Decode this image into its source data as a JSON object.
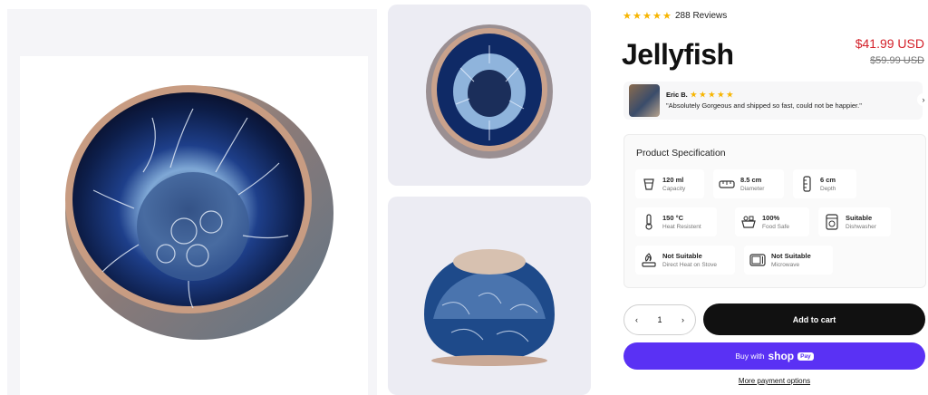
{
  "product": {
    "title": "Jellyfish",
    "price": "$41.99 USD",
    "compare_price": "$59.99 USD",
    "rating_stars": 5,
    "reviews_label": "288 Reviews"
  },
  "testimonial": {
    "name": "Eric B.",
    "quote": "\"Absolutely Gorgeous and shipped so fast, could not be happier.\""
  },
  "spec": {
    "title": "Product Specification",
    "items": [
      {
        "value": "120 ml",
        "label": "Capacity",
        "icon": "cup-icon"
      },
      {
        "value": "8.5 cm",
        "label": "Diameter",
        "icon": "ruler-icon"
      },
      {
        "value": "6 cm",
        "label": "Depth",
        "icon": "depth-ruler-icon"
      },
      {
        "value": "150 °C",
        "label": "Heat Resistent",
        "icon": "thermometer-icon"
      },
      {
        "value": "100%",
        "label": "Food Safe",
        "icon": "food-safe-icon"
      },
      {
        "value": "Suitable",
        "label": "Dishwasher",
        "icon": "dishwasher-icon"
      },
      {
        "value": "Not Suitable",
        "label": "Direct Heat on Stove",
        "icon": "stove-flame-icon"
      },
      {
        "value": "Not Suitable",
        "label": "Microwave",
        "icon": "microwave-icon"
      }
    ]
  },
  "cart": {
    "quantity": "1",
    "add_label": "Add to cart",
    "shop_prefix": "Buy with",
    "shop_brand": "shop",
    "shop_pay": "Pay",
    "more_options": "More payment options"
  },
  "colors": {
    "price": "#d4222b",
    "star": "#f7b500",
    "shop_pay": "#5a31f4",
    "add_button": "#111111"
  }
}
